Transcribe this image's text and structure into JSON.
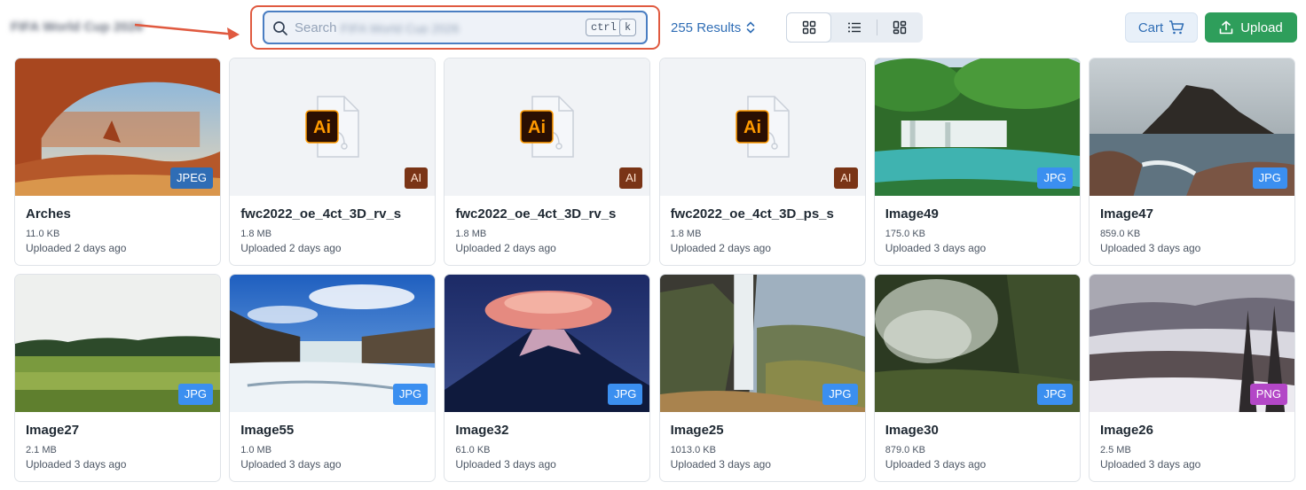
{
  "header": {
    "collection_title": "FIFA World Cup 2026",
    "search": {
      "placeholder": "Search",
      "blurred_query": "FIFA World Cup 2026",
      "shortcut_keys": [
        "ctrl",
        "k"
      ]
    },
    "results_label": "255 Results",
    "view_modes": [
      "grid-view",
      "list-view",
      "gallery-view"
    ],
    "active_view": "grid-view",
    "cart_label": "Cart",
    "upload_label": "Upload"
  },
  "colors": {
    "accent": "#2f6db5",
    "upload": "#2e9e5b",
    "highlight": "#e05a40",
    "badge_jpeg": "#2f6db5",
    "badge_jpg": "#3b8ff0",
    "badge_png": "#b347c7",
    "badge_ai": "#7a3416"
  },
  "assets": [
    {
      "name": "Arches",
      "size": "11.0 KB",
      "uploaded": "Uploaded 2 days ago",
      "badge": "JPEG",
      "thumb": "arches"
    },
    {
      "name": "fwc2022_oe_4ct_3D_rv_s",
      "size": "1.8 MB",
      "uploaded": "Uploaded 2 days ago",
      "badge": "AI",
      "thumb": "ai-file"
    },
    {
      "name": "fwc2022_oe_4ct_3D_rv_s",
      "size": "1.8 MB",
      "uploaded": "Uploaded 2 days ago",
      "badge": "AI",
      "thumb": "ai-file"
    },
    {
      "name": "fwc2022_oe_4ct_3D_ps_s",
      "size": "1.8 MB",
      "uploaded": "Uploaded 2 days ago",
      "badge": "AI",
      "thumb": "ai-file"
    },
    {
      "name": "Image49",
      "size": "175.0 KB",
      "uploaded": "Uploaded 3 days ago",
      "badge": "JPG",
      "thumb": "waterfall-forest"
    },
    {
      "name": "Image47",
      "size": "859.0 KB",
      "uploaded": "Uploaded 3 days ago",
      "badge": "JPG",
      "thumb": "sea-rock"
    },
    {
      "name": "Image27",
      "size": "2.1 MB",
      "uploaded": "Uploaded 3 days ago",
      "badge": "JPG",
      "thumb": "grass-field"
    },
    {
      "name": "Image55",
      "size": "1.0 MB",
      "uploaded": "Uploaded 3 days ago",
      "badge": "JPG",
      "thumb": "frozen-falls"
    },
    {
      "name": "Image32",
      "size": "61.0 KB",
      "uploaded": "Uploaded 3 days ago",
      "badge": "JPG",
      "thumb": "cloud-mountain"
    },
    {
      "name": "Image25",
      "size": "1013.0 KB",
      "uploaded": "Uploaded 3 days ago",
      "badge": "JPG",
      "thumb": "cliff-waterfall"
    },
    {
      "name": "Image30",
      "size": "879.0 KB",
      "uploaded": "Uploaded 3 days ago",
      "badge": "JPG",
      "thumb": "misty-forest"
    },
    {
      "name": "Image26",
      "size": "2.5 MB",
      "uploaded": "Uploaded 3 days ago",
      "badge": "PNG",
      "thumb": "snowy-forest"
    }
  ]
}
